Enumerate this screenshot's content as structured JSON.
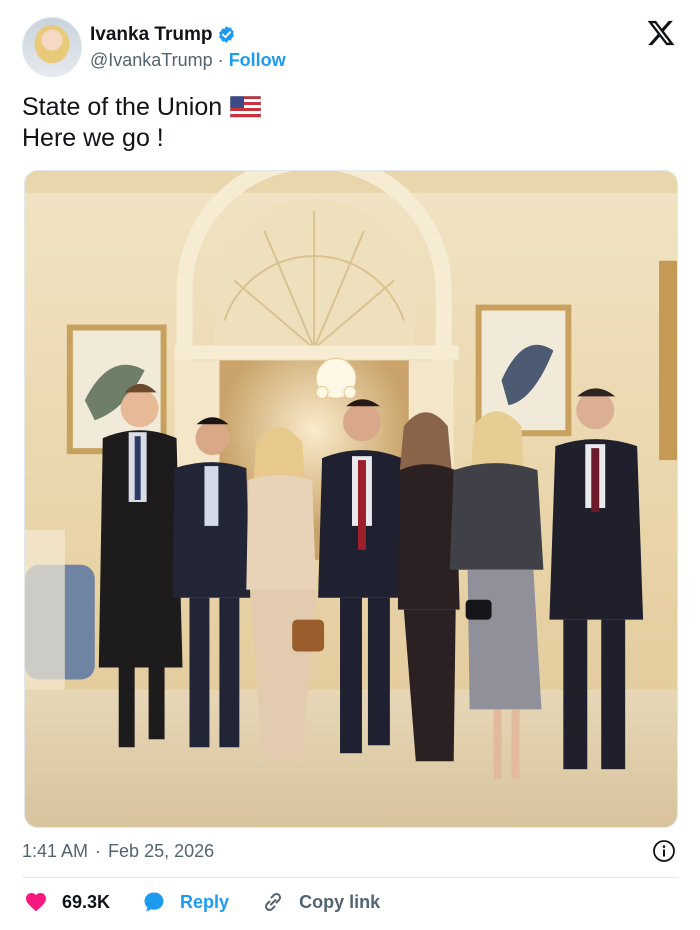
{
  "author": {
    "name": "Ivanka Trump",
    "handle": "@IvankaTrump",
    "separator": "·",
    "follow_label": "Follow"
  },
  "tweet": {
    "line1": "State of the Union",
    "line2": "Here we go !"
  },
  "meta": {
    "time": "1:41 AM",
    "separator": "·",
    "date": "Feb 25, 2026"
  },
  "actions": {
    "likes": "69.3K",
    "reply_label": "Reply",
    "copy_label": "Copy link"
  },
  "icons": [
    "verified-badge-icon",
    "x-logo-icon",
    "us-flag-icon",
    "info-icon",
    "heart-icon",
    "reply-bubble-icon",
    "link-icon"
  ],
  "colors": {
    "accent": "#1d9bf0",
    "like": "#f91880",
    "text": "#0f1419",
    "muted": "#536471"
  }
}
